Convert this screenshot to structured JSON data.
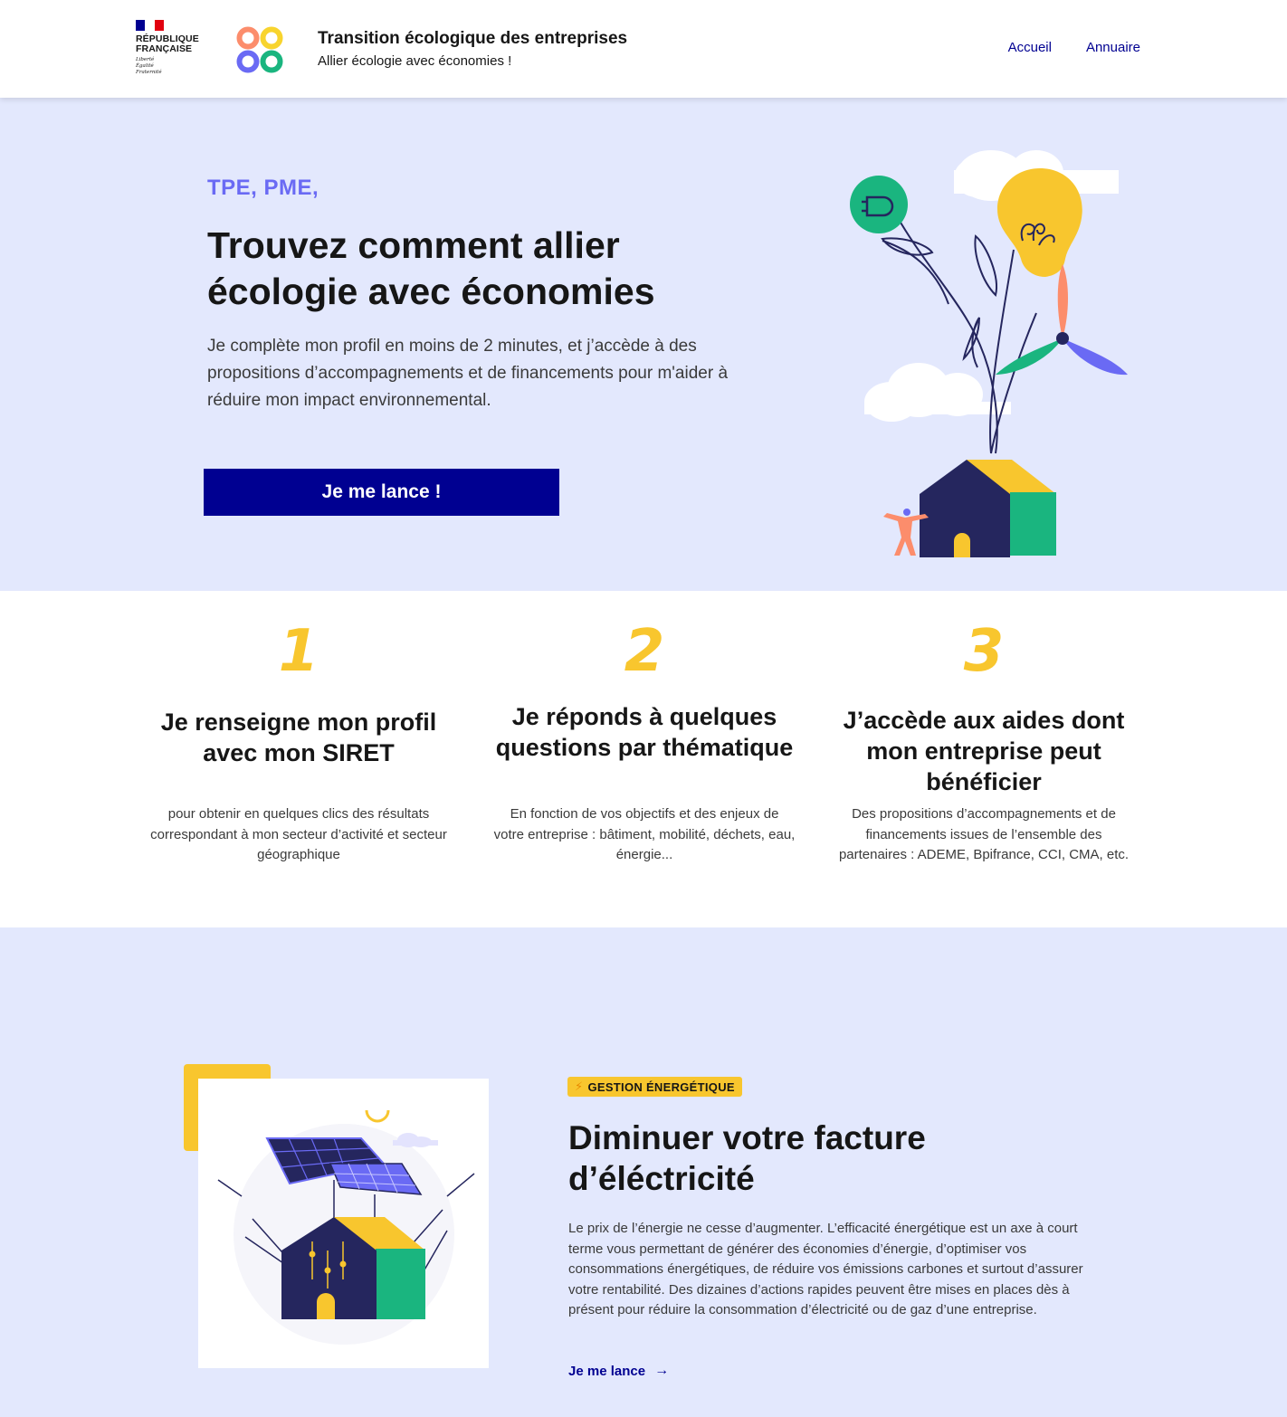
{
  "header": {
    "rf_lines": [
      "RÉPUBLIQUE",
      "FRANÇAISE"
    ],
    "devise_lines": [
      "Liberté",
      "Égalité",
      "Fraternité"
    ],
    "service_title": "Transition écologique des entreprises",
    "service_tagline": "Allier écologie avec économies !",
    "nav": [
      {
        "label": "Accueil"
      },
      {
        "label": "Annuaire"
      }
    ],
    "colors": {
      "blue": "#000091",
      "flag_blue": "#000091",
      "flag_red": "#e1000f"
    }
  },
  "hero": {
    "kicker": "TPE, PME,",
    "title": "Trouvez comment allier écologie avec économies",
    "text": "Je complète mon profil en moins de 2 minutes, et j’accède à des propositions d’accompagnements et de financements pour m'aider à réduire mon impact environnemental.",
    "cta": "Je me lance !",
    "illustration_icons": [
      "plug-icon",
      "lightbulb-icon",
      "wind-turbine-icon",
      "house-icon",
      "person-icon",
      "cloud-icon"
    ],
    "colors": {
      "background": "#e3e8fd",
      "kicker": "#6a6af4",
      "button": "#000091"
    }
  },
  "steps": [
    {
      "number": "1",
      "title": "Je renseigne mon profil avec mon SIRET",
      "text": "pour obtenir en quelques clics des résultats correspondant à mon secteur d’activité et secteur géographique"
    },
    {
      "number": "2",
      "title": "Je réponds à quelques questions par thématique",
      "text": "En fonction de vos objectifs et des enjeux de votre entreprise : bâtiment, mobilité, déchets, eau, énergie..."
    },
    {
      "number": "3",
      "title": "J’accède aux aides dont mon entreprise peut bénéficier",
      "text": "Des propositions d’accompagnements et de financements issues de l’ensemble des partenaires : ADEME, Bpifrance, CCI, CMA, etc."
    }
  ],
  "theme": {
    "badge_icon": "lightning-icon",
    "badge_glyph": "⚡",
    "badge": "GESTION ÉNERGÉTIQUE",
    "title": "Diminuer votre facture d’éléctricité",
    "text": "Le prix de l’énergie ne cesse d’augmenter. L’efficacité énergétique est un axe à court terme vous permettant de générer des économies d’énergie, d’optimiser vos consommations énergétiques, de réduire vos émissions carbones et surtout d’assurer votre rentabilité. Des dizaines d’actions rapides peuvent être mises en places dès à présent pour réduire la consommation d’électricité ou de gaz d’une entreprise.",
    "link": "Je me lance",
    "link_arrow": "→",
    "illustration_icons": [
      "solar-panel-icon",
      "house-icon",
      "sun-icon",
      "cloud-icon"
    ],
    "colors": {
      "accent": "#f8c62e",
      "navy": "#25265e",
      "green": "#1ab57f"
    }
  }
}
